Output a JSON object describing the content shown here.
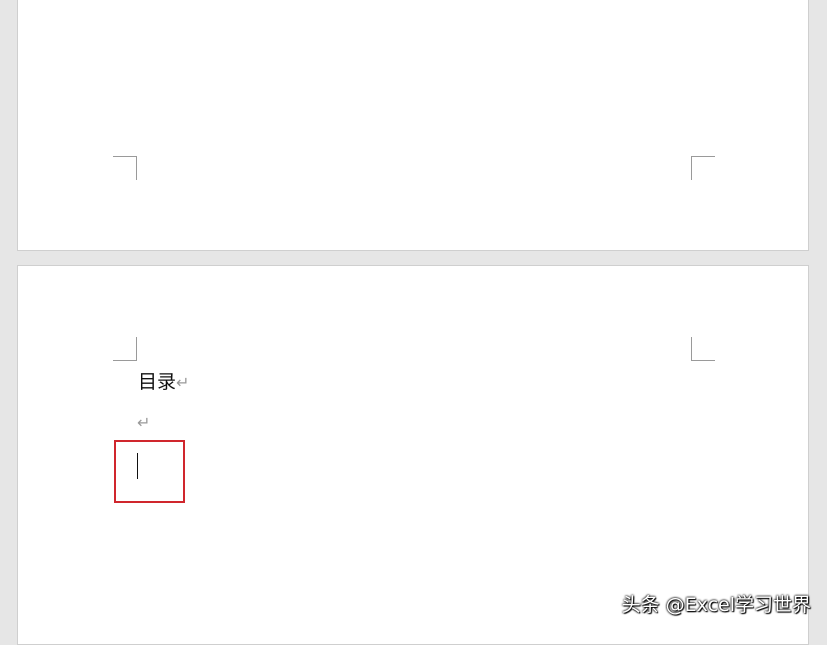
{
  "document": {
    "toc_heading": "目录",
    "paragraph_mark": "↵"
  },
  "watermark": {
    "text": "头条 @Excel学习世界"
  },
  "colors": {
    "background": "#e6e6e6",
    "page": "#ffffff",
    "highlight": "#d0262d",
    "crop_mark": "#9a9a9a"
  }
}
